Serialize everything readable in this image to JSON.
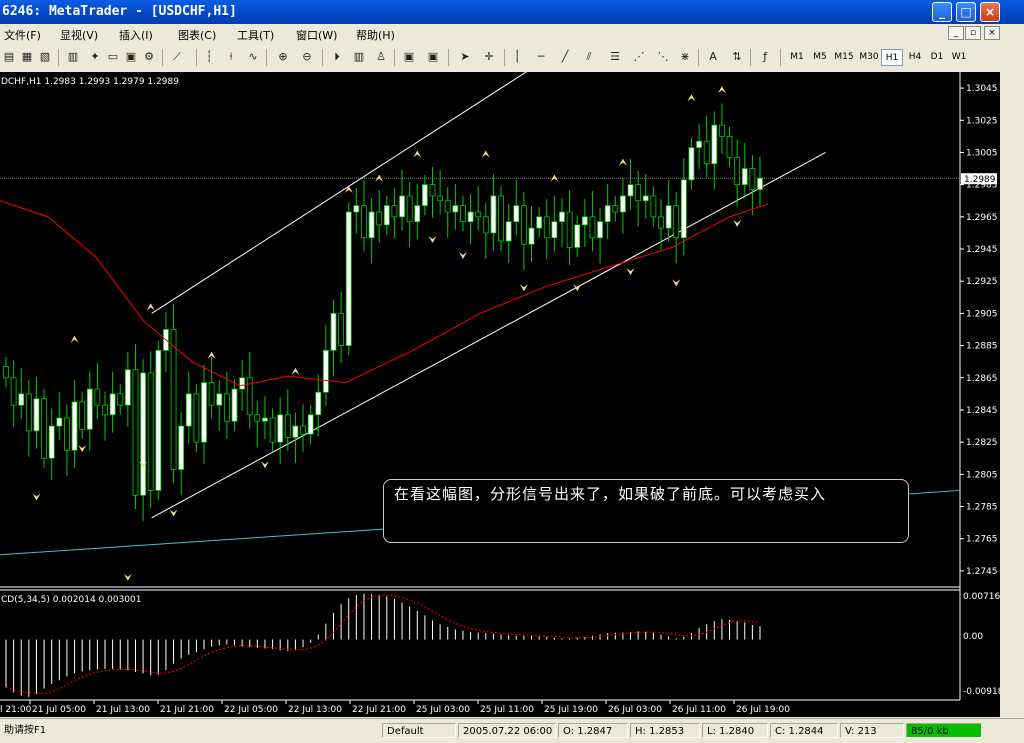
{
  "window": {
    "title": "6246: MetaTrader - [USDCHF,H1]",
    "buttons": [
      "_",
      "□",
      "×"
    ]
  },
  "menu": [
    "文件(F)",
    "显视(V)",
    "插入(I)",
    "图表(C)",
    "工具(T)",
    "窗口(W)",
    "帮助(H)"
  ],
  "mdi_buttons": [
    "_",
    "▫",
    "×"
  ],
  "toolbar": {
    "icons": [
      "new-chart-icon",
      "open-icon",
      "save-icon",
      "print-icon",
      "market-watch-icon",
      "navigator-icon",
      "terminal-icon",
      "tester-icon",
      "options-icon",
      "expert-icon",
      "bar-chart-icon",
      "candles-icon",
      "line-chart-icon",
      "zoom-in-icon",
      "zoom-out-icon",
      "autoscroll-icon",
      "chart-shift-icon",
      "template-icon",
      "profile-icon",
      "cursor-icon",
      "crosshair-icon",
      "vline-icon",
      "hline-icon",
      "trendline-icon",
      "equidistant-channel-icon",
      "fibo-icon",
      "text-icon",
      "arrow-icon",
      "period-icon"
    ],
    "timeframes": [
      "M1",
      "M5",
      "M15",
      "M30",
      "H1",
      "H4",
      "D1",
      "W1"
    ],
    "active_timeframe": "H1"
  },
  "chart": {
    "header": "DCHF,H1  1.2983 1.2993 1.2979 1.2989",
    "current_price": "1.2989",
    "colors": {
      "bull": "#ffffff",
      "bear": "#000000",
      "wick": "#00cc00",
      "ma": "#ff0000",
      "channel": "#ffffff",
      "support": "#3cc8c8",
      "fractal": "#f0d890",
      "macd_line": "#ff0000"
    },
    "annotation": "在看这幅图，分形信号出来了，如果破了前底。可以考虑买入",
    "macd_header": "CD(5,34,5)  0.002014  0.003001",
    "macd_ticks": [
      "0.00716",
      "0.00",
      "-0.00918"
    ]
  },
  "chart_data": {
    "type": "candlestick",
    "symbol": "USDCHF",
    "timeframe": "H1",
    "ylim": [
      1.2735,
      1.3055
    ],
    "y_ticks": [
      "1.3045",
      "1.3025",
      "1.3005",
      "1.2985",
      "1.2965",
      "1.2945",
      "1.2925",
      "1.2905",
      "1.2885",
      "1.2865",
      "1.2845",
      "1.2825",
      "1.2805",
      "1.2785",
      "1.2765",
      "1.2745"
    ],
    "x_ticks": [
      "21 Jul 05:00",
      "21 Jul 13:00",
      "21 Jul 21:00",
      "22 Jul 05:00",
      "22 Jul 13:00",
      "22 Jul 21:00",
      "25 Jul 03:00",
      "25 Jul 11:00",
      "25 Jul 19:00",
      "26 Jul 03:00",
      "26 Jul 11:00",
      "26 Jul 19:00"
    ],
    "x_tick_first": "l 21:00",
    "closes": [
      1.2865,
      1.2848,
      1.2855,
      1.2832,
      1.2852,
      1.2815,
      1.2835,
      1.284,
      1.282,
      1.285,
      1.2833,
      1.2858,
      1.2848,
      1.2842,
      1.2855,
      1.2848,
      1.287,
      1.2792,
      1.2868,
      1.2795,
      1.2882,
      1.2895,
      1.2808,
      1.2835,
      1.2855,
      1.2825,
      1.2862,
      1.2848,
      1.2855,
      1.2838,
      1.2858,
      1.2865,
      1.2842,
      1.2838,
      1.284,
      1.2825,
      1.2842,
      1.2828,
      1.2835,
      1.283,
      1.2842,
      1.2856,
      1.2882,
      1.2905,
      1.2885,
      1.2968,
      1.2972,
      1.2952,
      1.2968,
      1.296,
      1.2972,
      1.2965,
      1.2978,
      1.2962,
      1.2972,
      1.2985,
      1.2978,
      1.2975,
      1.2968,
      1.2972,
      1.2962,
      1.2968,
      1.2965,
      1.2955,
      1.2978,
      1.295,
      1.2962,
      1.2972,
      1.2948,
      1.2958,
      1.2965,
      1.2952,
      1.2962,
      1.2968,
      1.2946,
      1.296,
      1.2965,
      1.2952,
      1.2962,
      1.2972,
      1.2968,
      1.2978,
      1.2985,
      1.2975,
      1.2978,
      1.2965,
      1.2958,
      1.2972,
      1.2952,
      1.2988,
      1.3008,
      1.3012,
      1.2998,
      1.3022,
      1.3015,
      1.3002,
      1.2985,
      1.2995,
      1.2982,
      1.2989
    ],
    "ma_line": [
      [
        0,
        1.2975
      ],
      [
        0.05,
        1.2965
      ],
      [
        0.1,
        1.294
      ],
      [
        0.15,
        1.29
      ],
      [
        0.2,
        1.2875
      ],
      [
        0.25,
        1.286
      ],
      [
        0.3,
        1.2866
      ],
      [
        0.36,
        1.2862
      ],
      [
        0.43,
        1.2882
      ],
      [
        0.5,
        1.2905
      ],
      [
        0.57,
        1.2922
      ],
      [
        0.64,
        1.2935
      ],
      [
        0.7,
        1.2946
      ],
      [
        0.76,
        1.2965
      ],
      [
        0.8,
        1.2973
      ]
    ],
    "channel_upper": [
      [
        0.158,
        1.2905
      ],
      [
        0.6,
        1.3075
      ]
    ],
    "channel_lower": [
      [
        0.158,
        1.2778
      ],
      [
        0.86,
        1.3005
      ]
    ],
    "support_line": [
      [
        0,
        1.2755
      ],
      [
        1,
        1.2795
      ]
    ],
    "fractals_up": [
      1.2885,
      1.2905,
      1.2875,
      1.2865,
      1.2978,
      1.2985,
      1.3,
      1.3,
      1.2985,
      1.2995,
      1.3035,
      1.304
    ],
    "fractals_down": [
      1.2795,
      1.2825,
      1.2815,
      1.2785,
      1.2815,
      1.2955,
      1.2945,
      1.2925,
      1.2925,
      1.2935,
      1.2928,
      1.2965,
      1.2745
    ],
    "macd_values": [
      -0.0075,
      -0.0083,
      -0.0088,
      -0.009,
      -0.0085,
      -0.0077,
      -0.007,
      -0.0064,
      -0.0058,
      -0.0053,
      -0.005,
      -0.0048,
      -0.0047,
      -0.0046,
      -0.0046,
      -0.0047,
      -0.0048,
      -0.0051,
      -0.0053,
      -0.0056,
      -0.0055,
      -0.0048,
      -0.0038,
      -0.003,
      -0.0024,
      -0.002,
      -0.0015,
      -0.0011,
      -0.0009,
      -0.0008,
      -0.0009,
      -0.0011,
      -0.0012,
      -0.0013,
      -0.0014,
      -0.0015,
      -0.0017,
      -0.0018,
      -0.0017,
      -0.0012,
      -0.0005,
      0.0008,
      0.0025,
      0.0042,
      0.0056,
      0.0065,
      0.007,
      0.0072,
      0.0071,
      0.007,
      0.0068,
      0.0064,
      0.0058,
      0.0052,
      0.0045,
      0.0038,
      0.003,
      0.0024,
      0.002,
      0.0016,
      0.0014,
      0.0012,
      0.0011,
      0.001,
      0.0009,
      0.0008,
      0.0007,
      0.0006,
      0.0006,
      0.0006,
      0.0005,
      0.0004,
      0.0003,
      0.0002,
      0.0002,
      0.0003,
      0.0004,
      0.0006,
      0.0008,
      0.001,
      0.0011,
      0.0011,
      0.0012,
      0.0013,
      0.0012,
      0.0011,
      0.0008,
      0.0005,
      0.0002,
      0.0004,
      0.001,
      0.0018,
      0.0024,
      0.0029,
      0.0032,
      0.0031,
      0.0029,
      0.0027,
      0.0023,
      0.0021
    ],
    "macd_ylim": [
      -0.00918,
      0.00716
    ]
  },
  "status": {
    "help": "助请按F1",
    "profile": "Default",
    "time": "2005.07.22 06:00",
    "open": "O: 1.2847",
    "high": "H: 1.2853",
    "low": "L: 1.2840",
    "close": "C: 1.2844",
    "volume": "V: 213",
    "traffic": "85/0 kb"
  }
}
